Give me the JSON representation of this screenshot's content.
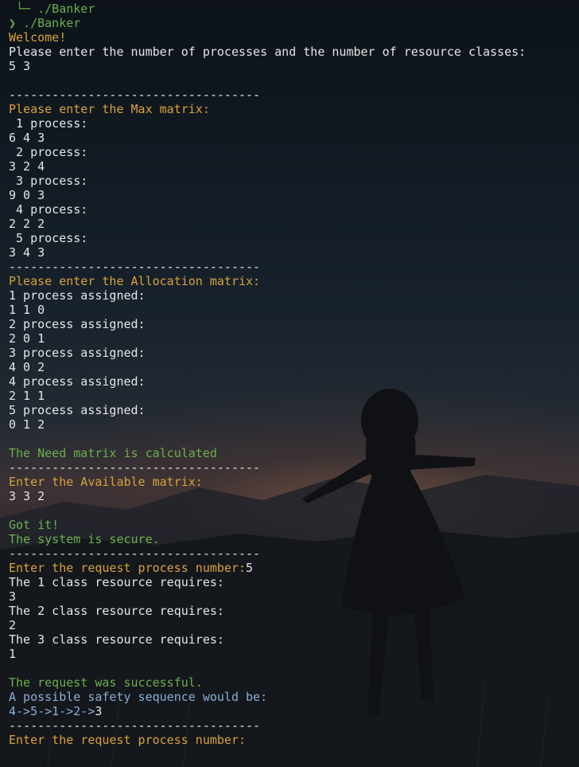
{
  "terminal": {
    "lines": [
      {
        "text": " └─ ./Banker",
        "color": "c-green"
      },
      {
        "text": "❯ ./Banker",
        "color": "c-green"
      },
      {
        "text": "Welcome!",
        "color": "c-gold"
      },
      {
        "text": "Please enter the number of processes and the number of resource classes:",
        "color": "c-white"
      },
      {
        "text": "5 3",
        "color": "c-white"
      },
      {
        "text": "",
        "color": "c-white"
      },
      {
        "text": "-----------------------------------",
        "color": "c-white"
      },
      {
        "text": "Please enter the Max matrix:",
        "color": "c-gold"
      },
      {
        "text": " 1 process:",
        "color": "c-white"
      },
      {
        "text": "6 4 3",
        "color": "c-white"
      },
      {
        "text": " 2 process:",
        "color": "c-white"
      },
      {
        "text": "3 2 4",
        "color": "c-white"
      },
      {
        "text": " 3 process:",
        "color": "c-white"
      },
      {
        "text": "9 0 3",
        "color": "c-white"
      },
      {
        "text": " 4 process:",
        "color": "c-white"
      },
      {
        "text": "2 2 2",
        "color": "c-white"
      },
      {
        "text": " 5 process:",
        "color": "c-white"
      },
      {
        "text": "3 4 3",
        "color": "c-white"
      },
      {
        "text": "-----------------------------------",
        "color": "c-white"
      },
      {
        "text": "Please enter the Allocation matrix:",
        "color": "c-gold"
      },
      {
        "text": "1 process assigned:",
        "color": "c-white"
      },
      {
        "text": "1 1 0",
        "color": "c-white"
      },
      {
        "text": "2 process assigned:",
        "color": "c-white"
      },
      {
        "text": "2 0 1",
        "color": "c-white"
      },
      {
        "text": "3 process assigned:",
        "color": "c-white"
      },
      {
        "text": "4 0 2",
        "color": "c-white"
      },
      {
        "text": "4 process assigned:",
        "color": "c-white"
      },
      {
        "text": "2 1 1",
        "color": "c-white"
      },
      {
        "text": "5 process assigned:",
        "color": "c-white"
      },
      {
        "text": "0 1 2",
        "color": "c-white"
      },
      {
        "text": "",
        "color": "c-white"
      },
      {
        "text": "The Need matrix is calculated",
        "color": "c-green"
      },
      {
        "text": "-----------------------------------",
        "color": "c-white"
      },
      {
        "text": "Enter the Available matrix:",
        "color": "c-gold"
      },
      {
        "text": "3 3 2",
        "color": "c-white"
      },
      {
        "text": "",
        "color": "c-white"
      },
      {
        "text": "Got it!",
        "color": "c-green"
      },
      {
        "text": "The system is secure.",
        "color": "c-green"
      },
      {
        "text": "-----------------------------------",
        "color": "c-white"
      },
      {
        "text": "Enter the request process number:",
        "color": "c-gold",
        "input": "5"
      },
      {
        "text": "The 1 class resource requires:",
        "color": "c-white"
      },
      {
        "text": "3",
        "color": "c-white"
      },
      {
        "text": "The 2 class resource requires:",
        "color": "c-white"
      },
      {
        "text": "2",
        "color": "c-white"
      },
      {
        "text": "The 3 class resource requires:",
        "color": "c-white"
      },
      {
        "text": "1",
        "color": "c-white"
      },
      {
        "text": "",
        "color": "c-white"
      },
      {
        "text": "The request was successful.",
        "color": "c-green"
      },
      {
        "text": "A possible safety sequence would be:",
        "color": "c-blue"
      },
      {
        "text": "4->5->1->2->",
        "color": "c-blue",
        "input": "3"
      },
      {
        "text": "-----------------------------------",
        "color": "c-white"
      },
      {
        "text": "Enter the request process number:",
        "color": "c-gold"
      }
    ]
  },
  "colors": {
    "green": "#6ab04c",
    "gold": "#d9a23a",
    "white": "#e4e6e8",
    "blue": "#8aaed8"
  }
}
